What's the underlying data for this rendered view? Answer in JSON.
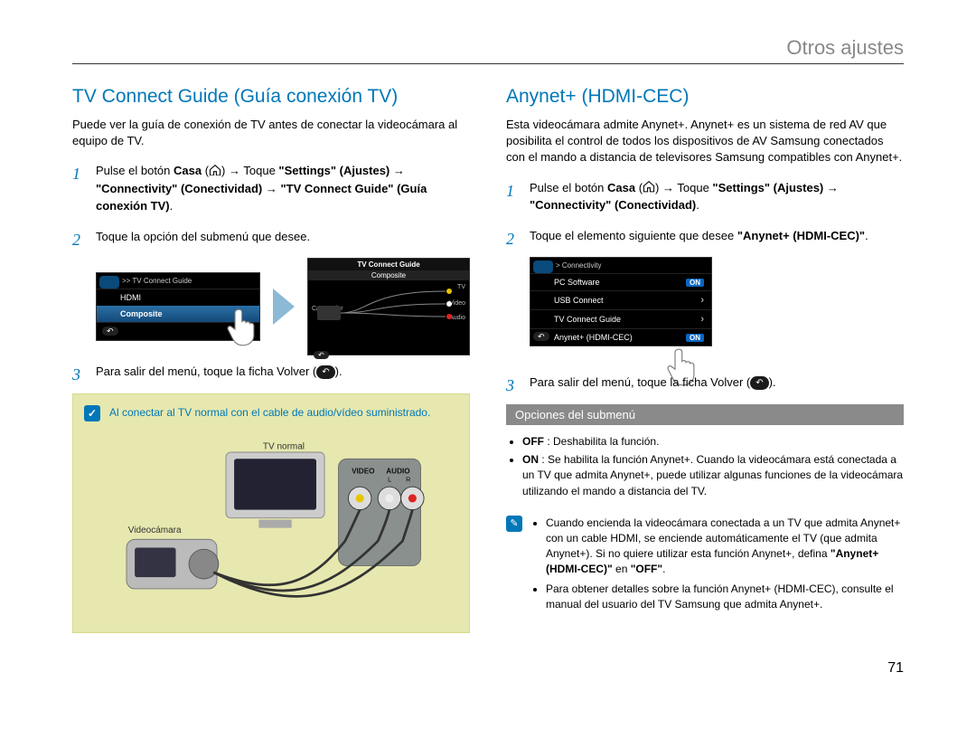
{
  "section_title": "Otros ajustes",
  "page_number": "71",
  "left": {
    "heading": "TV Connect Guide (Guía conexión TV)",
    "intro": "Puede ver la guía de conexión de TV antes de conectar la videocámara al equipo de TV.",
    "step1_a": "Pulse el botón ",
    "step1_casa": "Casa",
    "step1_b": " → Toque ",
    "step1_settings": "\"Settings\" (Ajustes)",
    "step1_c": " → ",
    "step1_conn": "\"Connectivity\" (Conectividad)",
    "step1_d": " → ",
    "step1_tvg": "\"TV Connect Guide\" (Guía conexión TV)",
    "step1_e": ".",
    "step2": "Toque la opción del submenú que desee.",
    "step3_a": "Para salir del menú, toque la ficha Volver (",
    "step3_b": ").",
    "screen1": {
      "breadcrumb": ">> TV Connect Guide",
      "item1": "HDMI",
      "item2": "Composite"
    },
    "screen2": {
      "title": "TV Connect Guide",
      "subtitle": "Composite",
      "l_cam": "Camcorder",
      "l_tv": "TV",
      "l_video": "Video",
      "l_audio": "Audio"
    },
    "note": "Al conectar al TV normal con el cable de audio/vídeo suministrado.",
    "illus_tv": "TV normal",
    "illus_cam": "Videocámara",
    "illus_video": "VIDEO",
    "illus_audio": "AUDIO",
    "illus_l": "L",
    "illus_r": "R"
  },
  "right": {
    "heading": "Anynet+ (HDMI-CEC)",
    "intro": "Esta videocámara admite Anynet+. Anynet+ es un sistema de red AV que posibilita el control de todos los dispositivos de AV Samsung conectados con el mando a distancia de televisores Samsung compatibles con Anynet+.",
    "step1_a": "Pulse el botón ",
    "step1_casa": "Casa",
    "step1_b": " → Toque ",
    "step1_settings": "\"Settings\" (Ajustes)",
    "step1_c": " → ",
    "step1_conn": "\"Connectivity\" (Conectividad)",
    "step1_d": ".",
    "step2_a": "Toque el elemento siguiente que desee ",
    "step2_b": "\"Anynet+ (HDMI-CEC)\"",
    "step2_c": ".",
    "step3_a": "Para salir del menú, toque la ficha Volver (",
    "step3_b": ").",
    "screen": {
      "breadcrumb": "> Connectivity",
      "r1": "PC Software",
      "r1_badge": "ON",
      "r2": "USB Connect",
      "r3": "TV Connect Guide",
      "r4": "Anynet+ (HDMI-CEC)",
      "r4_badge": "ON"
    },
    "submenu_head": "Opciones del submenú",
    "opt_off_label": "OFF",
    "opt_off_text": " : Deshabilita la función.",
    "opt_on_label": "ON",
    "opt_on_text": " : Se habilita la función Anynet+. Cuando la videocámara está conectada a un TV que admita Anynet+, puede utilizar algunas funciones de la videocámara utilizando el mando a distancia del TV.",
    "info1_a": "Cuando encienda la videocámara conectada a un TV que admita Anynet+ con un cable HDMI, se enciende automáticamente el TV (que admita Anynet+). Si no quiere utilizar esta función Anynet+, defina ",
    "info1_b": "\"Anynet+ (HDMI-CEC)\"",
    "info1_c": " en ",
    "info1_d": "\"OFF\"",
    "info1_e": ".",
    "info2": "Para obtener detalles sobre la función Anynet+ (HDMI-CEC), consulte el manual del usuario del TV Samsung que admita Anynet+."
  }
}
